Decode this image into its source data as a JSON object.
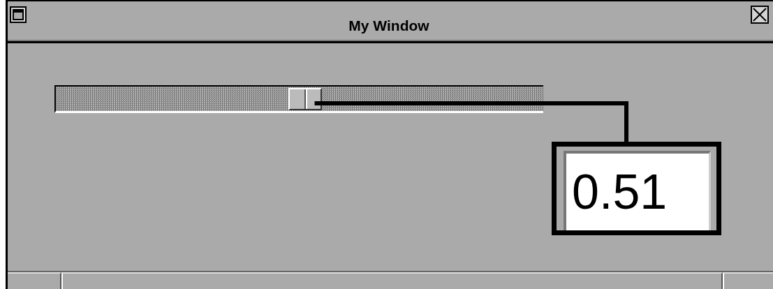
{
  "window": {
    "title": "My Window"
  },
  "slider": {
    "level": 0.51
  },
  "value_display": {
    "value": "0.51"
  }
}
